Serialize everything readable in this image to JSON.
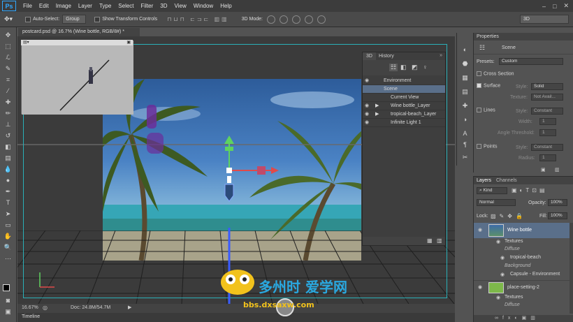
{
  "app": {
    "logo": "Ps"
  },
  "menu": [
    "File",
    "Edit",
    "Image",
    "Layer",
    "Type",
    "Select",
    "Filter",
    "3D",
    "View",
    "Window",
    "Help"
  ],
  "window_controls": [
    "–",
    "□",
    "✕"
  ],
  "options_bar": {
    "auto_select_label": "Auto-Select:",
    "auto_select_value": "Group",
    "transform_label": "Show Transform Controls",
    "mode_3d_label": "3D Mode:",
    "workspace": "3D"
  },
  "document": {
    "tab_title": "postcard.psd @ 16.7% (Wine bottle, RGB/8#) *",
    "zoom": "16.67%",
    "doc_size": "Doc: 24.8M/54.7M",
    "timeline_label": "Timeline"
  },
  "panel_3d": {
    "tabs": [
      "3D",
      "History"
    ],
    "items": [
      {
        "label": "Environment",
        "indent": 0
      },
      {
        "label": "Scene",
        "indent": 0,
        "selected": true
      },
      {
        "label": "Current View",
        "indent": 1
      },
      {
        "label": "Wine bottle_Layer",
        "indent": 1
      },
      {
        "label": "tropical-beach_Layer",
        "indent": 1
      },
      {
        "label": "Infinite Light 1",
        "indent": 1
      }
    ]
  },
  "properties": {
    "tab": "Properties",
    "section": "Scene",
    "presets_label": "Presets:",
    "presets_value": "Custom",
    "cross_section": "Cross Section",
    "surface": "Surface",
    "surface_style_label": "Style:",
    "surface_style_value": "Solid",
    "texture_label": "Texture:",
    "texture_value": "Not Avail...",
    "lines": "Lines",
    "lines_style_label": "Style:",
    "lines_style_value": "Constant",
    "width_label": "Width:",
    "width_value": "1",
    "angle_label": "Angle Threshold:",
    "angle_value": "1",
    "points": "Points",
    "points_style_label": "Style:",
    "points_style_value": "Constant",
    "radius_label": "Radius:",
    "radius_value": "1"
  },
  "layers_panel": {
    "tabs": [
      "Layers",
      "Channels"
    ],
    "kind_label": "Kind",
    "blend_mode": "Normal",
    "opacity_label": "Opacity:",
    "opacity_value": "100%",
    "lock_label": "Lock:",
    "fill_label": "Fill:",
    "fill_value": "100%",
    "rows": [
      {
        "label": "Wine bottle",
        "type": "layer",
        "selected": true
      },
      {
        "label": "Textures",
        "type": "sub"
      },
      {
        "label": "Diffuse",
        "type": "italic"
      },
      {
        "label": "tropical-beach",
        "type": "sub2"
      },
      {
        "label": "Background",
        "type": "italic"
      },
      {
        "label": "Capsule - Environment",
        "type": "sub2"
      },
      {
        "label": "place-setting-2",
        "type": "layer"
      },
      {
        "label": "Textures",
        "type": "sub"
      },
      {
        "label": "Diffuse",
        "type": "italic"
      }
    ]
  },
  "watermark": {
    "text": "bbs.dxsaxw.com",
    "cn": "多州时  爱学网"
  },
  "colors": {
    "accent_guide": "#2ab0b8",
    "selection": "#5a6f8a",
    "axis_green": "#5fd35f",
    "axis_red": "#e04a4a",
    "axis_blue": "#3a5cff"
  }
}
